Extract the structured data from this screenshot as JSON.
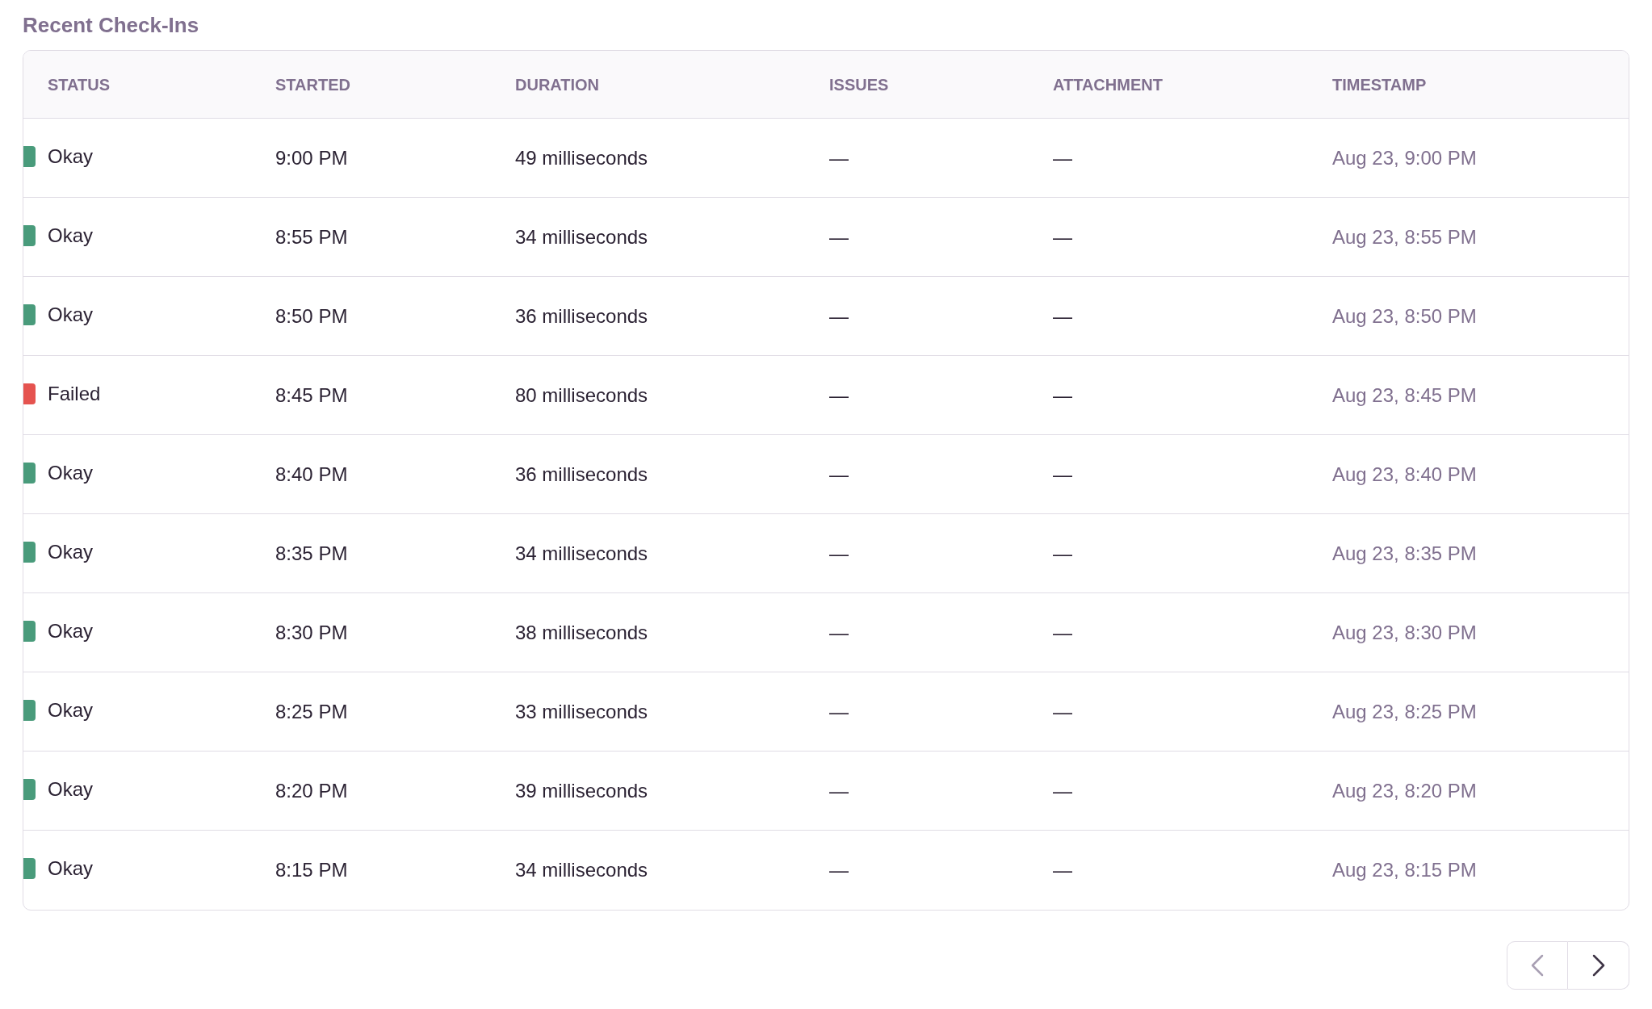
{
  "title": "Recent Check-Ins",
  "table": {
    "columns": [
      "STATUS",
      "STARTED",
      "DURATION",
      "ISSUES",
      "ATTACHMENT",
      "TIMESTAMP"
    ],
    "rows": [
      {
        "status": "Okay",
        "color": "#499b7b",
        "started": "9:00 PM",
        "duration": "49 milliseconds",
        "issues": "—",
        "attachment": "—",
        "timestamp": "Aug 23, 9:00 PM"
      },
      {
        "status": "Okay",
        "color": "#499b7b",
        "started": "8:55 PM",
        "duration": "34 milliseconds",
        "issues": "—",
        "attachment": "—",
        "timestamp": "Aug 23, 8:55 PM"
      },
      {
        "status": "Okay",
        "color": "#499b7b",
        "started": "8:50 PM",
        "duration": "36 milliseconds",
        "issues": "—",
        "attachment": "—",
        "timestamp": "Aug 23, 8:50 PM"
      },
      {
        "status": "Failed",
        "color": "#e5534f",
        "started": "8:45 PM",
        "duration": "80 milliseconds",
        "issues": "—",
        "attachment": "—",
        "timestamp": "Aug 23, 8:45 PM"
      },
      {
        "status": "Okay",
        "color": "#499b7b",
        "started": "8:40 PM",
        "duration": "36 milliseconds",
        "issues": "—",
        "attachment": "—",
        "timestamp": "Aug 23, 8:40 PM"
      },
      {
        "status": "Okay",
        "color": "#499b7b",
        "started": "8:35 PM",
        "duration": "34 milliseconds",
        "issues": "—",
        "attachment": "—",
        "timestamp": "Aug 23, 8:35 PM"
      },
      {
        "status": "Okay",
        "color": "#499b7b",
        "started": "8:30 PM",
        "duration": "38 milliseconds",
        "issues": "—",
        "attachment": "—",
        "timestamp": "Aug 23, 8:30 PM"
      },
      {
        "status": "Okay",
        "color": "#499b7b",
        "started": "8:25 PM",
        "duration": "33 milliseconds",
        "issues": "—",
        "attachment": "—",
        "timestamp": "Aug 23, 8:25 PM"
      },
      {
        "status": "Okay",
        "color": "#499b7b",
        "started": "8:20 PM",
        "duration": "39 milliseconds",
        "issues": "—",
        "attachment": "—",
        "timestamp": "Aug 23, 8:20 PM"
      },
      {
        "status": "Okay",
        "color": "#499b7b",
        "started": "8:15 PM",
        "duration": "34 milliseconds",
        "issues": "—",
        "attachment": "—",
        "timestamp": "Aug 23, 8:15 PM"
      }
    ]
  },
  "pagination": {
    "previous": {
      "disabled": true
    },
    "next": {
      "disabled": false
    }
  }
}
